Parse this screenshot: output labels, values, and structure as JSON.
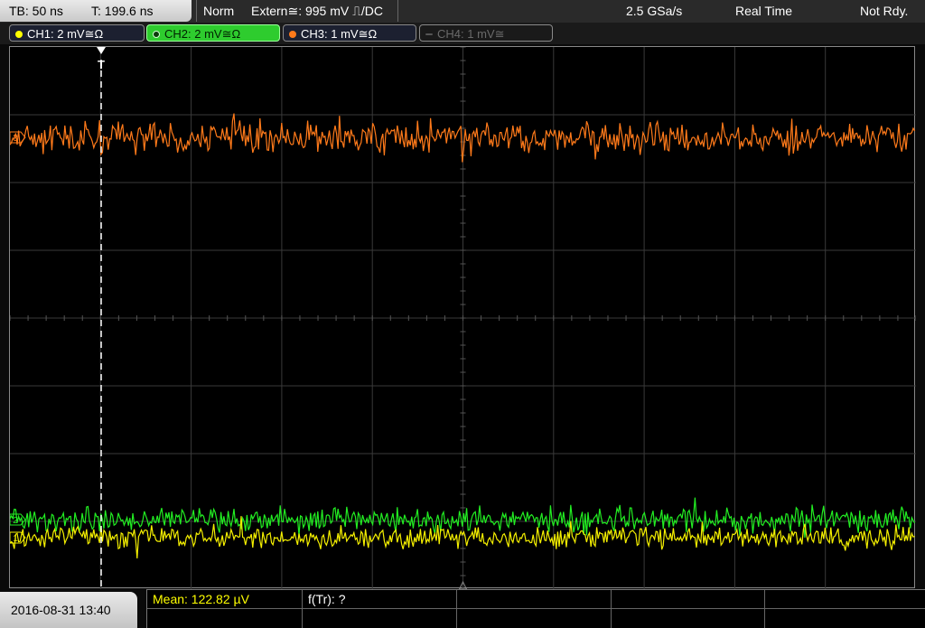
{
  "topbar": {
    "timebase": "TB: 50 ns",
    "trigger_time": "T: 199.6 ns",
    "trigger_mode": "Norm",
    "trigger_source": "Extern≅: 995 mV ⎍/DC",
    "sample_rate": "2.5 GSa/s",
    "acq_mode": "Real Time",
    "status": "Not Rdy."
  },
  "channels": [
    {
      "label": "CH1: 2 mV≅Ω",
      "color": "#ffff00",
      "state": "on"
    },
    {
      "label": "CH2: 2 mV≅Ω",
      "color": "#33ff33",
      "state": "selected"
    },
    {
      "label": "CH3: 1 mV≅Ω",
      "color": "#ff7a1a",
      "state": "on"
    },
    {
      "label": "CH4: 1 mV≅",
      "color": "#777777",
      "state": "off"
    }
  ],
  "plot": {
    "trigger_marker": "T",
    "channel_markers": [
      "3",
      "2",
      "1"
    ],
    "colors": {
      "ch1": "#f5f000",
      "ch2": "#22ee22",
      "ch3": "#ff7a1a",
      "grid": "#3a3a3a",
      "trigger": "#ffffff"
    }
  },
  "footer": {
    "datetime": "2016-08-31 13:40",
    "measurement_mean": "Mean: 122.82 µV",
    "measurement_freq": "f(Tr): ?"
  }
}
